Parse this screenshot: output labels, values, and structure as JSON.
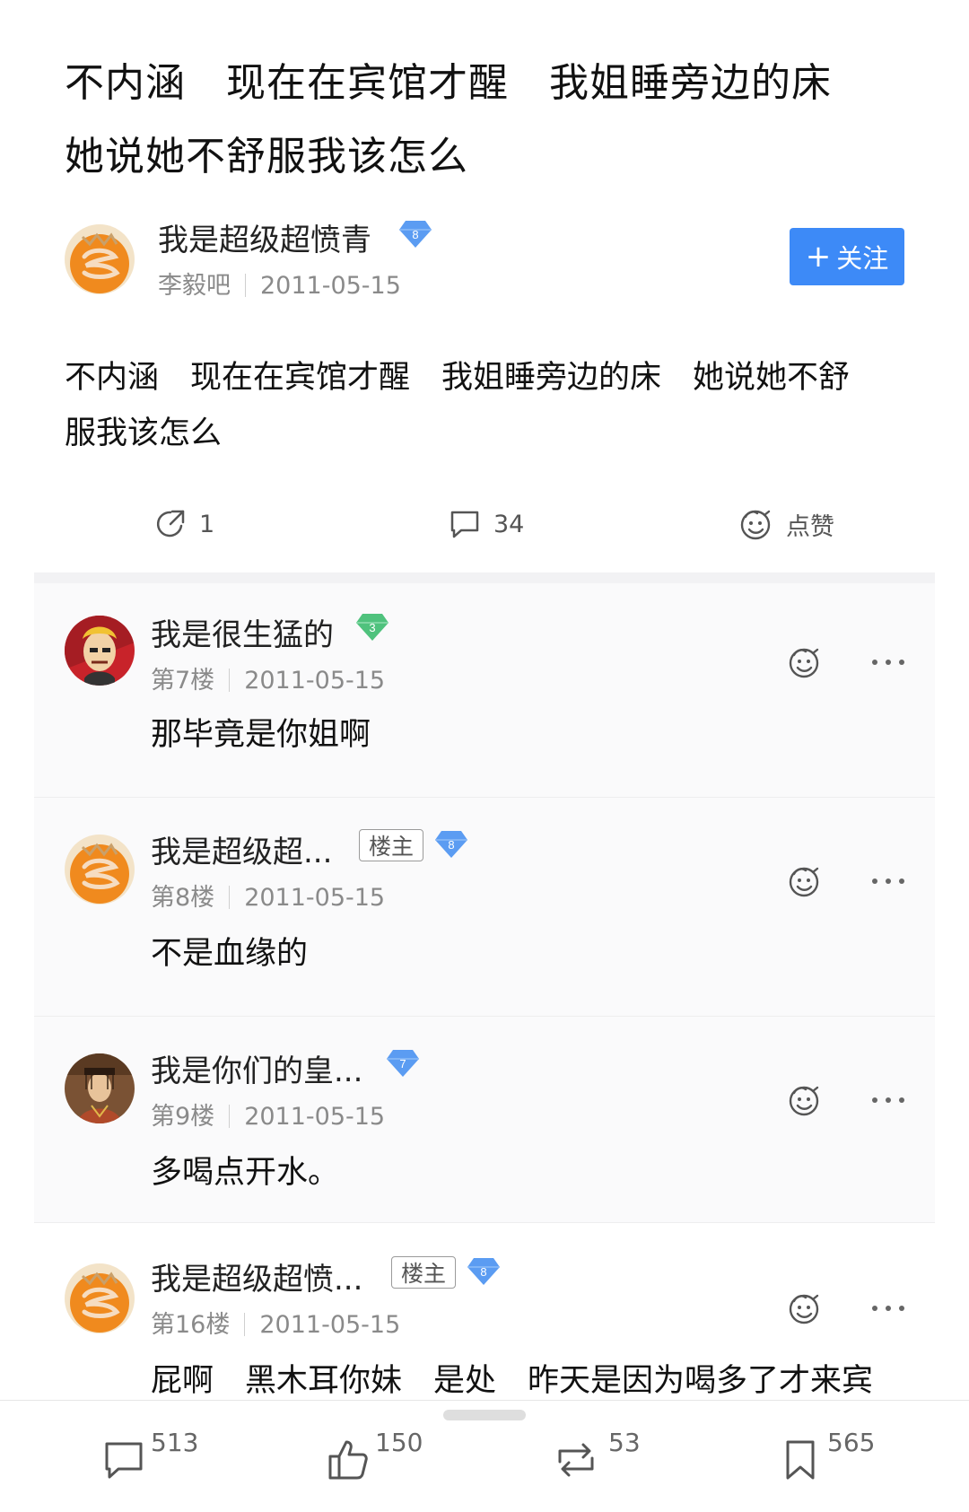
{
  "post": {
    "title": "不内涵　现在在宾馆才醒　我姐睡旁边的床\n她说她不舒服我该怎么",
    "author": {
      "name": "我是超级超愤青",
      "level": "8",
      "avatar_icon": "orange-avatar"
    },
    "forum": "李毅吧",
    "date": "2011-05-15",
    "follow_label": "关注",
    "body": "不内涵　现在在宾馆才醒　我姐睡旁边的床　她说她不舒\n服我该怎么",
    "actions": {
      "share_count": "1",
      "comment_count": "34",
      "like_label": "点赞"
    }
  },
  "comments": [
    {
      "name": "我是很生猛的",
      "level": "3",
      "floor": "第7楼",
      "date": "2011-05-15",
      "text": "那毕竟是你姐啊",
      "avatar_icon": "cartoon-avatar"
    },
    {
      "name": "我是超级超...",
      "tag": "楼主",
      "level": "8",
      "floor": "第8楼",
      "date": "2011-05-15",
      "text": "不是血缘的",
      "avatar_icon": "orange-avatar"
    },
    {
      "name": "我是你们的皇...",
      "level": "7",
      "floor": "第9楼",
      "date": "2011-05-15",
      "text": "多喝点开水。",
      "avatar_icon": "emperor-avatar"
    },
    {
      "name": "我是超级超愤...",
      "tag": "楼主",
      "level": "8",
      "floor": "第16楼",
      "date": "2011-05-15",
      "text": "屁啊　黑木耳你妹　是处　昨天是因为喝多了才来宾",
      "avatar_icon": "orange-avatar"
    }
  ],
  "bottom_bar": {
    "comments": "513",
    "likes": "150",
    "reposts": "53",
    "favorites": "565"
  },
  "colors": {
    "accent": "#3d8af7",
    "badge_blue": "#5b9cf2",
    "badge_green": "#4fc27d",
    "avatar_orange": "#f08a1e"
  }
}
